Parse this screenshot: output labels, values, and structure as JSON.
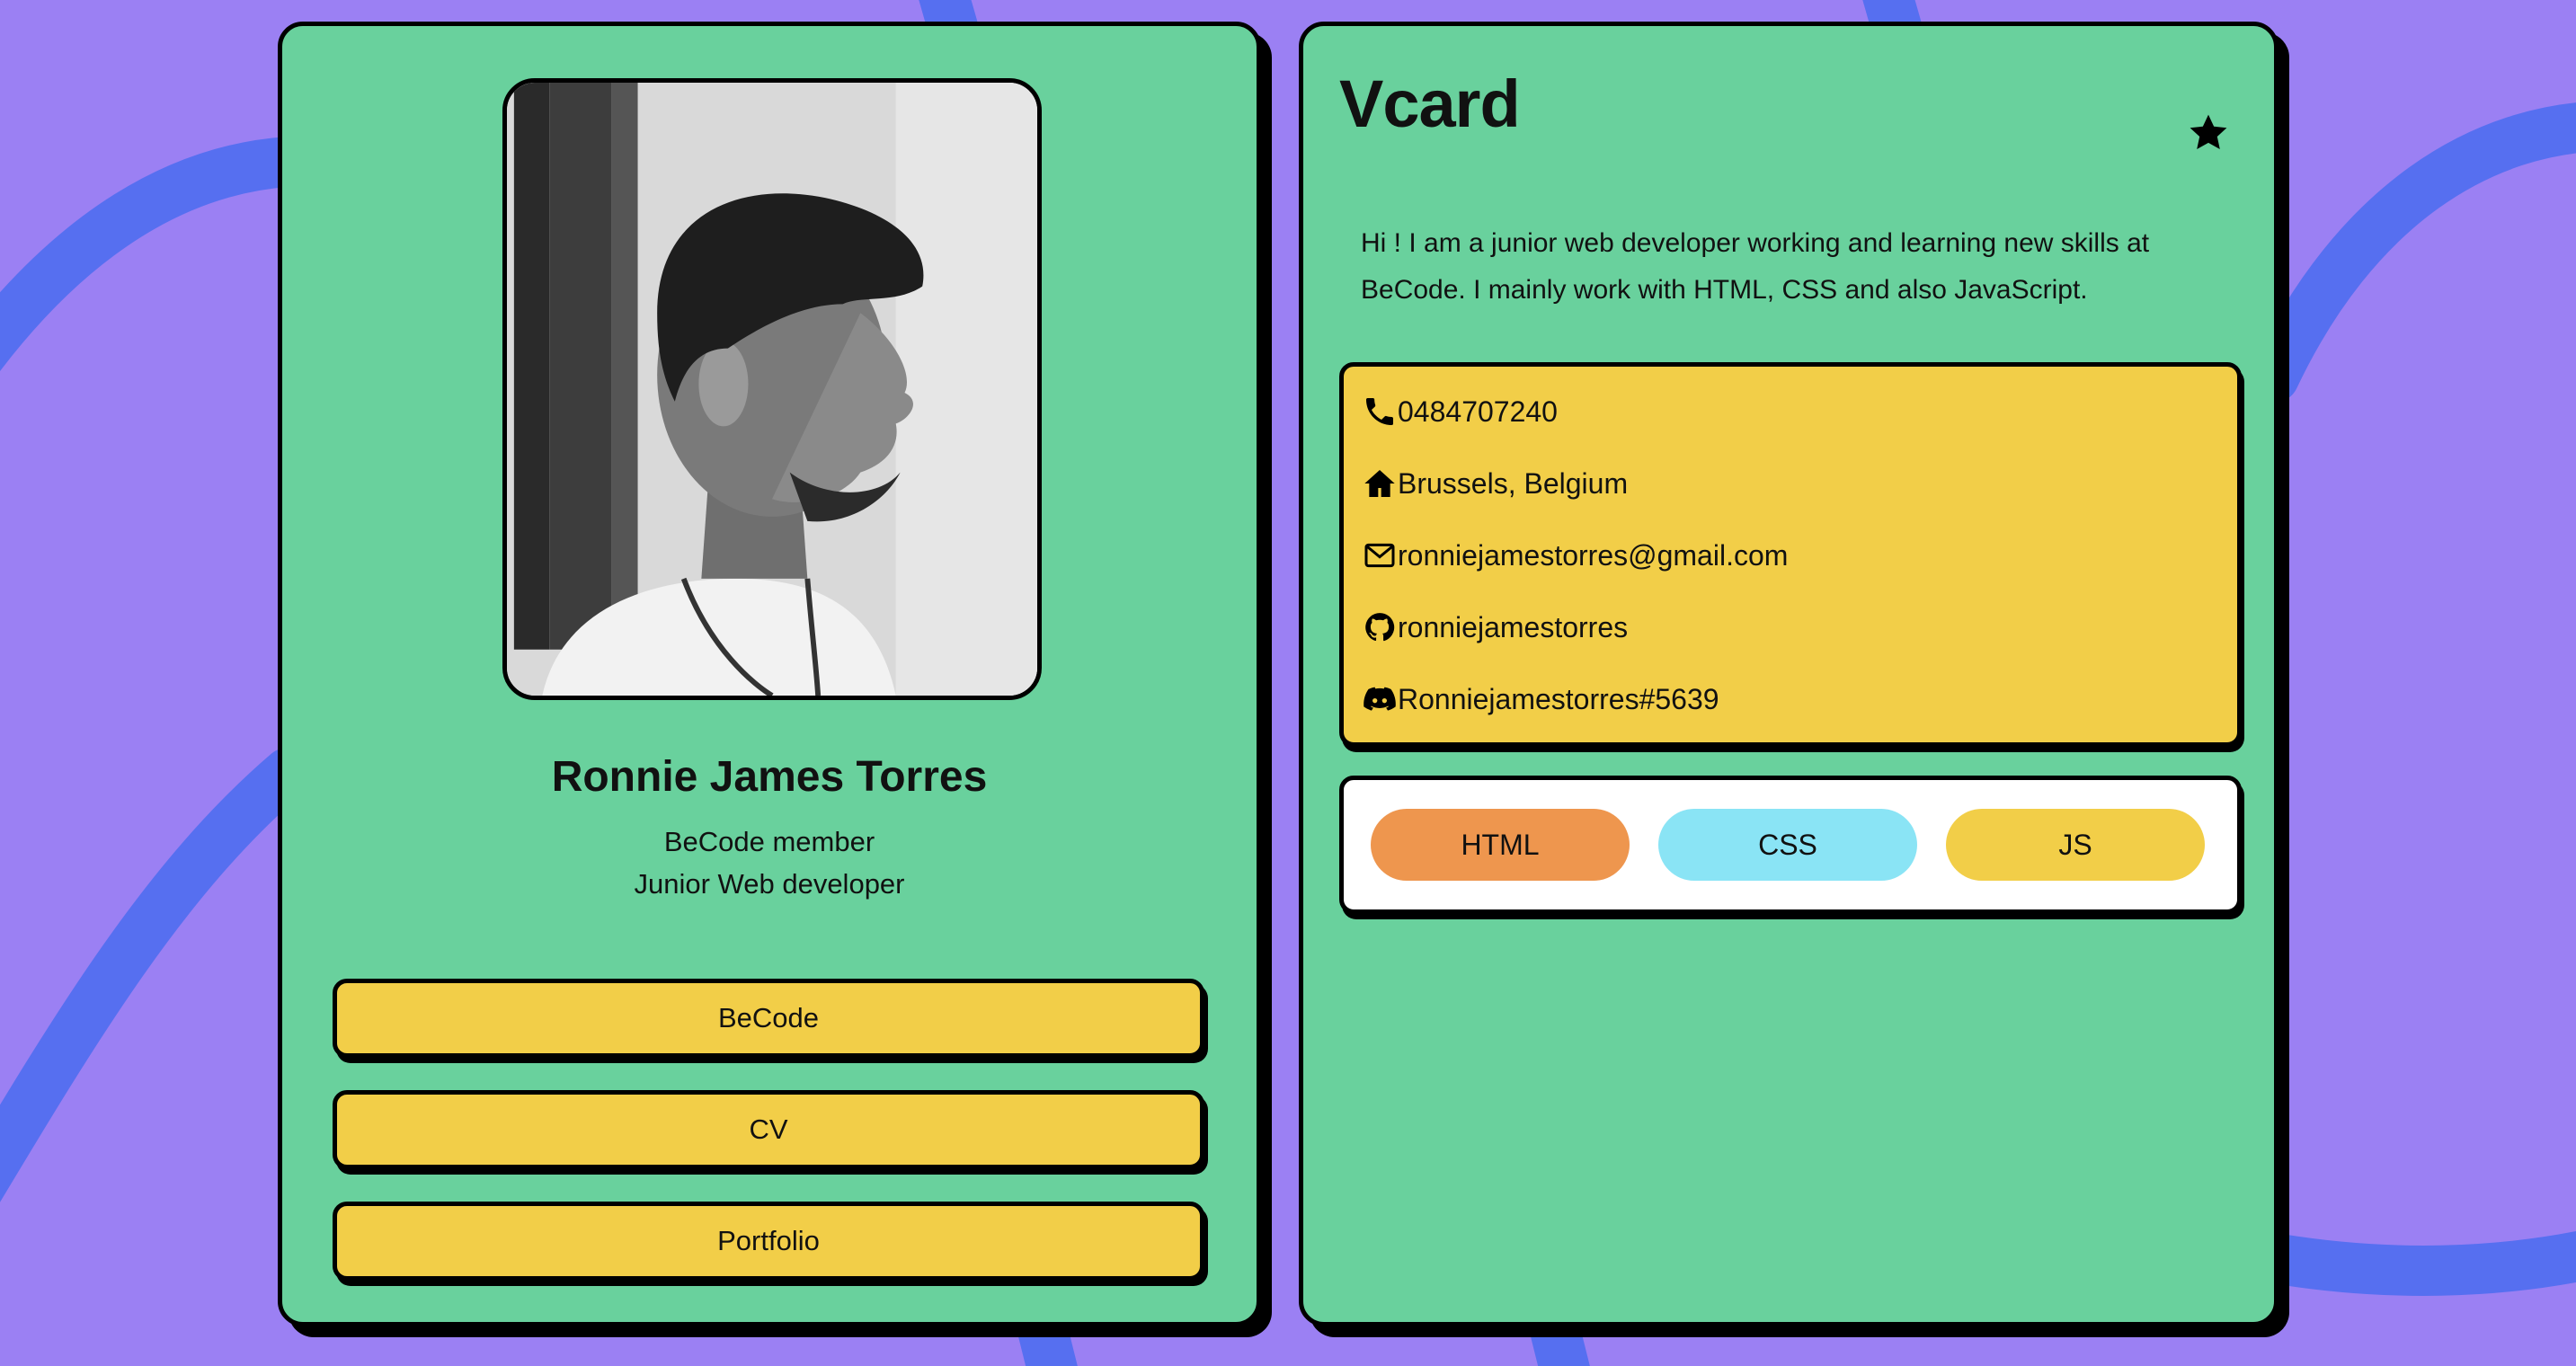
{
  "colors": {
    "background": "#9b80f3",
    "wave": "#566ff0",
    "card": "#69d19d",
    "button": "#f2ce48",
    "contact_box": "#f2ce48",
    "skills_box": "#ffffff",
    "skill_html": "#ee964e",
    "skill_css": "#8ae4f5",
    "skill_js": "#f2ce48"
  },
  "profile": {
    "name": "Ronnie James Torres",
    "role_line1": "BeCode member",
    "role_line2": "Junior Web developer",
    "links": [
      {
        "label": "BeCode"
      },
      {
        "label": "CV"
      },
      {
        "label": "Portfolio"
      }
    ]
  },
  "vcard": {
    "title": "Vcard",
    "favorite_icon": "star-icon",
    "intro": "Hi ! I am a junior web developer working and learning new skills at BeCode. I mainly work with HTML, CSS and also JavaScript.",
    "contacts": [
      {
        "icon": "phone-icon",
        "text": "0484707240"
      },
      {
        "icon": "home-icon",
        "text": "Brussels, Belgium"
      },
      {
        "icon": "envelope-icon",
        "text": "ronniejamestorres@gmail.com"
      },
      {
        "icon": "github-icon",
        "text": "ronniejamestorres"
      },
      {
        "icon": "discord-icon",
        "text": "Ronniejamestorres#5639"
      }
    ],
    "skills": [
      {
        "label": "HTML"
      },
      {
        "label": "CSS"
      },
      {
        "label": "JS"
      }
    ]
  }
}
